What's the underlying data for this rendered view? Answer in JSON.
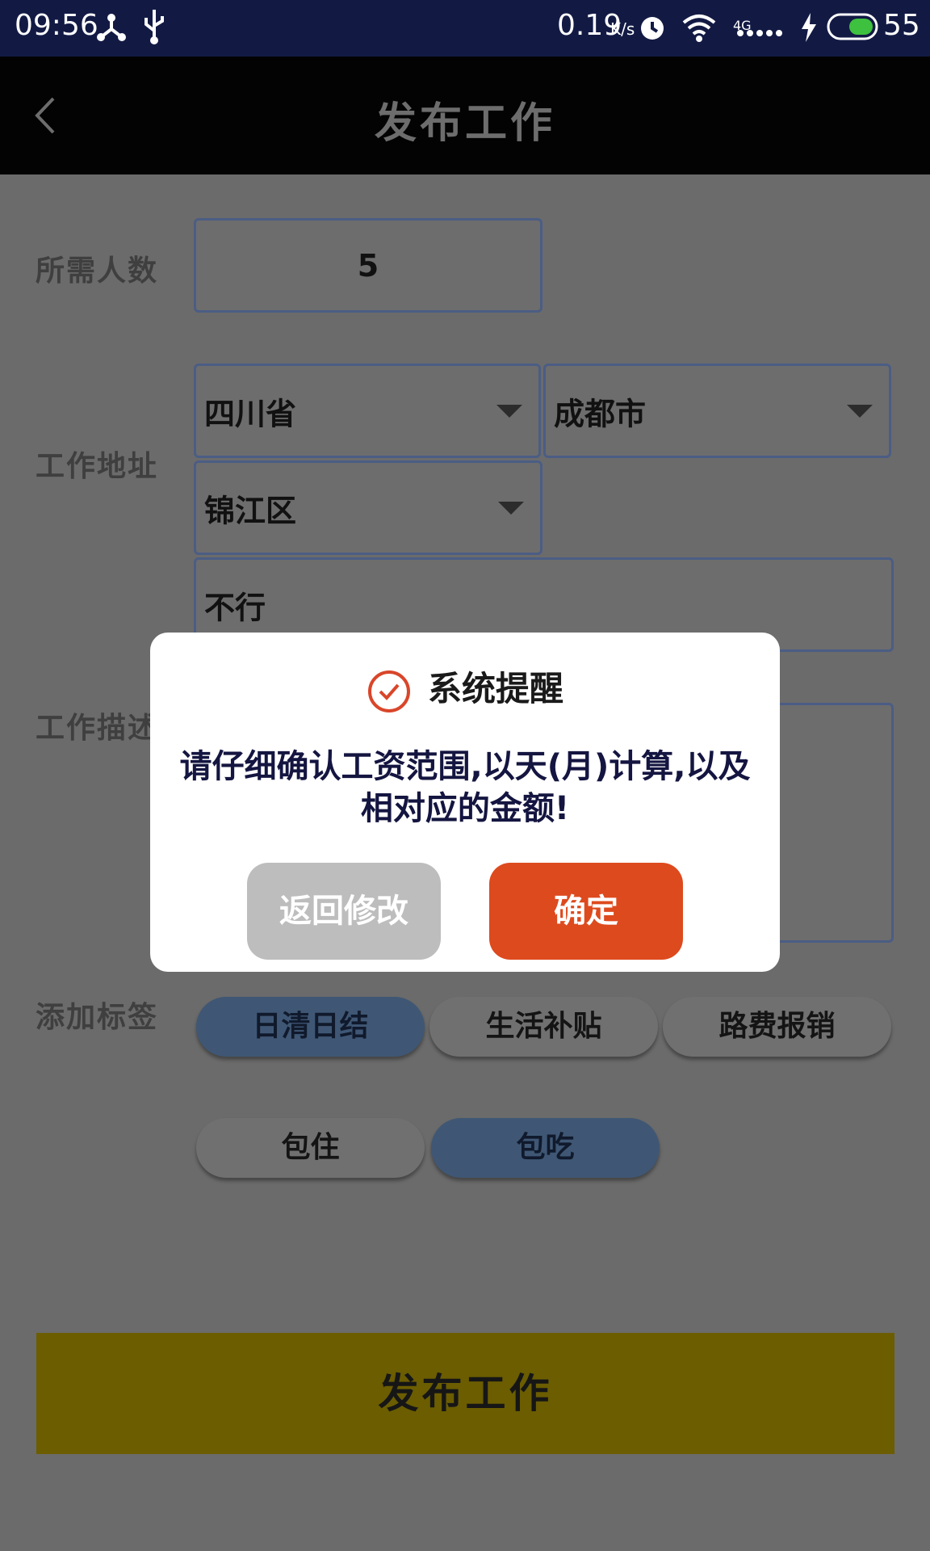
{
  "status_bar": {
    "time": "09:56",
    "net_speed": "0.19",
    "net_speed_unit": "K/s",
    "network": "4G",
    "battery": "55",
    "icons": [
      "share-icon",
      "usb-icon",
      "alarm-icon",
      "wifi-icon",
      "signal-icon",
      "charging-icon",
      "battery-icon"
    ]
  },
  "header": {
    "title": "发布工作",
    "back_icon": "chevron-left-icon"
  },
  "form": {
    "people_label": "所需人数",
    "people_value": "5",
    "address_label": "工作地址",
    "province": "四川省",
    "city": "成都市",
    "district": "锦江区",
    "street": "不行",
    "description_label": "工作描述",
    "tags_label": "添加标签",
    "tags": [
      {
        "label": "日清日结",
        "selected": true
      },
      {
        "label": "生活补贴",
        "selected": false
      },
      {
        "label": "路费报销",
        "selected": false
      },
      {
        "label": "包住",
        "selected": false
      },
      {
        "label": "包吃",
        "selected": true
      }
    ]
  },
  "publish_button": "发布工作",
  "dialog": {
    "title": "系统提醒",
    "message": "请仔细确认工资范围,以天(月)计算,以及相对应的金额!",
    "cancel": "返回修改",
    "confirm": "确定"
  },
  "colors": {
    "status_bar": "#121a44",
    "confirm": "#dd4a1e",
    "cancel": "#bdbdbd",
    "publish": "#6b5d00",
    "tag_selected": "#3f5774"
  }
}
